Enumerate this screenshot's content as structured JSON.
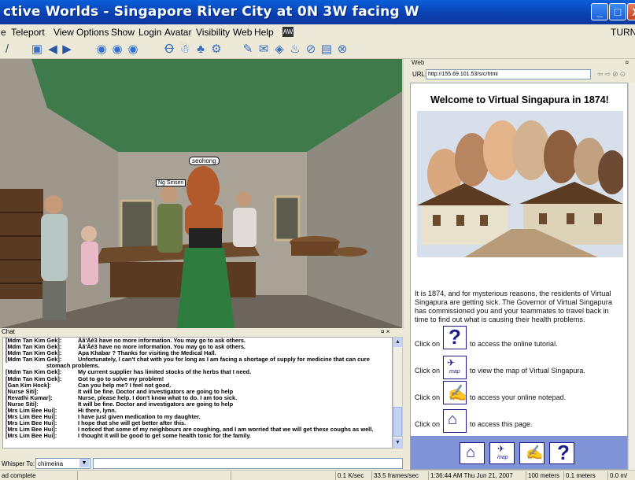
{
  "window": {
    "title": "ctive Worlds - Singapore River City at 0N 3W facing W",
    "min_glyph": "_",
    "max_glyph": "□",
    "close_glyph": "X"
  },
  "menu": {
    "items": [
      "Teleport",
      "View",
      "Options",
      "Show",
      "Login",
      "Avatar",
      "Visibility",
      "Web",
      "Help"
    ],
    "first_fragment": "e",
    "turn_label": "TURN"
  },
  "toolbar": {
    "icons": [
      "back-icon",
      "forward-icon",
      "left-icon",
      "right-icon",
      "home-icon",
      "circle-left-icon",
      "circle-center-icon",
      "circle-right-icon",
      "gesture-icon",
      "avatar-icon",
      "people-icon",
      "settings-icon",
      "paint-icon",
      "bookmark-icon",
      "diamond-icon",
      "chat-icon",
      "camera-icon",
      "photo-icon",
      "close-icon"
    ]
  },
  "viewport": {
    "avatar_labels": [
      "seohong",
      "Ng Sinsen"
    ]
  },
  "web": {
    "header": "Web",
    "url_label": "URL:",
    "url": "http://155.69.101.53/src/html",
    "welcome": "Welcome to Virtual Singapura in 1874!",
    "intro": "It is 1874, and for mysterious reasons, the residents of Virtual Singapura are getting sick. The Governor of Virtual Singapura has commissioned you and your teammates to travel back in time to find out what is causing their health problems.",
    "links": [
      {
        "prefix": "Click on",
        "suffix": "to access the online tutorial.",
        "icon": "help-icon"
      },
      {
        "prefix": "Click on",
        "suffix": "to view the map of Virtual Singapura.",
        "icon": "map-icon",
        "icon_text": "map"
      },
      {
        "prefix": "Click on",
        "suffix": "to access your online notepad.",
        "icon": "notepad-icon"
      },
      {
        "prefix": "Click on",
        "suffix": "to access this page.",
        "icon": "home-icon"
      }
    ],
    "nav_map_text": "map"
  },
  "chat": {
    "header": "Chat",
    "lines": [
      {
        "who": "[Mdm Tan Kim Gek]:",
        "msg": "Ãã'Ãé3 have no more information. You may go to ask others."
      },
      {
        "who": "[Mdm Tan Kim Gek]:",
        "msg": "Ãã'Ãé3 have no more information. You may go to ask others."
      },
      {
        "who": "[Mdm Tan Kim Gek]:",
        "msg": "Apa Khabar ? Thanks for visiting the Medical Hall."
      },
      {
        "who": "[Mdm Tan Kim Gek]:",
        "msg": "Unfortunately, I can't chat with you for long as I am facing a shortage of supply for medicine that can cure"
      },
      {
        "who": "",
        "msg": "stomach problems.",
        "cont": true
      },
      {
        "who": "[Mdm Tan Kim Gek]:",
        "msg": "My current supplier has limited stocks of the herbs that I need."
      },
      {
        "who": "[Mdm Tan Kim Gek]:",
        "msg": "Got to go to solve my problem!"
      },
      {
        "who": "[Gan Kim Hock]:",
        "msg": "Can you help me? I feel not good."
      },
      {
        "who": "[Nurse Siti]:",
        "msg": "It will be fine. Doctor and investigators are going to help"
      },
      {
        "who": "[Revathi Kumar]:",
        "msg": "Nurse, please help. I don't know what to do. I am too sick."
      },
      {
        "who": "[Nurse Siti]:",
        "msg": "It will be fine. Doctor and investigators are going to help"
      },
      {
        "who": "[Mrs Lim Bee Hui]:",
        "msg": "Hi there, lynn."
      },
      {
        "who": "[Mrs Lim Bee Hui]:",
        "msg": "I have just given medication to my daughter."
      },
      {
        "who": "[Mrs Lim Bee Hui]:",
        "msg": "I hope that she will get better after this."
      },
      {
        "who": "[Mrs Lim Bee Hui]:",
        "msg": "I noticed that some of my neighbours are coughing, and I am worried that we will get these coughs as well."
      },
      {
        "who": "[Mrs Lim Bee Hui]:",
        "msg": "I thought it will be good to get some health tonic for the family."
      }
    ],
    "whisper_label": "Whisper To:",
    "whisper_value": "chimeina",
    "input_value": ""
  },
  "status": {
    "left": "ad complete",
    "rate": "0.1 K/sec",
    "fps": "33.5 frames/sec",
    "time": "1:36:44 AM Thu Jun 21, 2007",
    "dist1": "100 meters",
    "dist2": "0.1 meters",
    "speed": "0.0 m/"
  },
  "colors": {
    "titlebar": "#0a4fc8",
    "nav_strip": "#7f93d6",
    "ceiling": "#3f7a4a"
  }
}
